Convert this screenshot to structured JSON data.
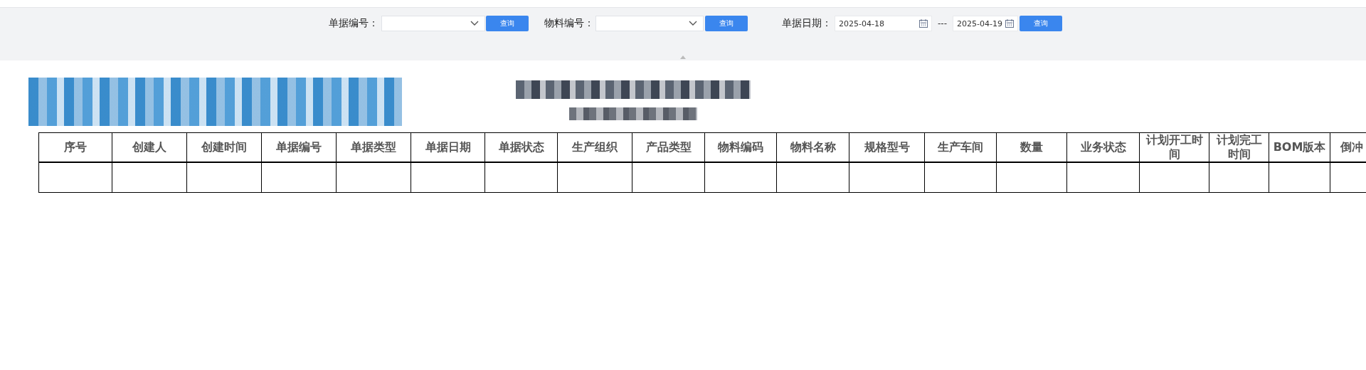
{
  "filters": [
    {
      "kind": "select",
      "label": "单据编号：",
      "button": "查询"
    },
    {
      "kind": "select",
      "label": "物料编号：",
      "button": "查询"
    },
    {
      "kind": "date-range",
      "label": "单据日期：",
      "from": "2025-04-18",
      "separator": "---",
      "to": "2025-04-19",
      "button": "查询"
    }
  ],
  "table": {
    "columns": [
      "序号",
      "创建人",
      "创建时间",
      "单据编号",
      "单据类型",
      "单据日期",
      "单据状态",
      "生产组织",
      "产品类型",
      "物料编码",
      "物料名称",
      "规格型号",
      "生产车间",
      "数量",
      "业务状态",
      "计划开工时间",
      "计划完工时间",
      "BOM版本",
      "倒冲"
    ]
  }
}
